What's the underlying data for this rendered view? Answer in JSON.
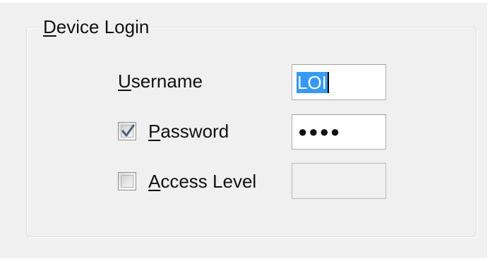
{
  "dialog": {
    "group_title_underlined": "D",
    "group_title_rest": "evice Login"
  },
  "username": {
    "label_underlined": "U",
    "label_rest": "sername",
    "value": "LOI"
  },
  "password": {
    "label_underlined": "P",
    "label_rest": "assword",
    "checked": true,
    "masked_value": "●●●●"
  },
  "access_level": {
    "label_underlined": "A",
    "label_rest": "ccess Level",
    "checked": false,
    "value": ""
  },
  "colors": {
    "selection": "#3399ff",
    "background": "#f0f0f0"
  }
}
